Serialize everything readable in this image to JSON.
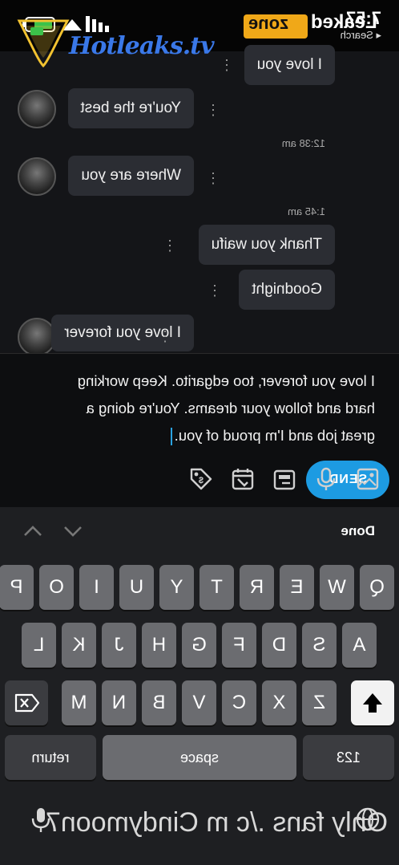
{
  "status_bar": {
    "time": "7:57",
    "app_back": "Search"
  },
  "chat": {
    "messages": [
      {
        "text": "I love you",
        "side": "right"
      },
      {
        "text": "You're the best",
        "side": "left",
        "avatar": true
      },
      {
        "time": "12:38 am"
      },
      {
        "text": "Where are you",
        "side": "left",
        "avatar": true
      },
      {
        "time": "1:45 am"
      },
      {
        "text": "Thank you waifu",
        "side": "right"
      },
      {
        "text": "Goodnight",
        "side": "right"
      },
      {
        "text": "I love you forever",
        "side": "left",
        "avatar": true
      }
    ]
  },
  "composer": {
    "line1": "I love you forever, too edgarito. Keep working",
    "line2": "hard and follow your dreams. You're doing a",
    "line3": "great job and I'm proud of you.",
    "send_label": "SEND",
    "toolbar_icons": [
      "image-icon",
      "microphone-icon",
      "media-icon",
      "calendar-icon",
      "tag-icon"
    ]
  },
  "keyboard": {
    "done_label": "Done",
    "row1": [
      "Q",
      "W",
      "E",
      "R",
      "T",
      "Y",
      "U",
      "I",
      "O",
      "P"
    ],
    "row2": [
      "A",
      "S",
      "D",
      "F",
      "G",
      "H",
      "J",
      "K",
      "L"
    ],
    "row3": [
      "Z",
      "X",
      "C",
      "V",
      "B",
      "N",
      "M"
    ],
    "numbers_label": "123",
    "space_label": "space",
    "return_label": "return",
    "bottom_text": "Only fans ./c m Cindymoon7"
  },
  "overlays": {
    "site_logo": "Hotleaks.tv",
    "watermark_leaked": "Leaked",
    "watermark_zone": "zone"
  }
}
